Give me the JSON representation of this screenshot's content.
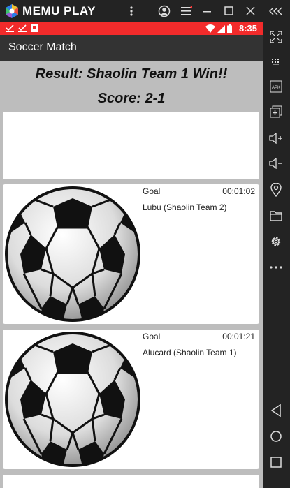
{
  "emulator": {
    "title": "MEMU PLAY",
    "controls": [
      "account-icon",
      "menu-icon",
      "minimize-icon",
      "maximize-icon",
      "close-icon",
      "collapse-icon"
    ]
  },
  "sidebar": {
    "buttons": [
      "fullscreen-icon",
      "keyboard-icon",
      "apk-icon",
      "add-app-icon",
      "volume-up-icon",
      "volume-down-icon",
      "location-icon",
      "folder-icon",
      "settings-icon",
      "more-icon",
      "back-icon",
      "home-icon",
      "recents-icon"
    ]
  },
  "status_bar": {
    "time": "8:35",
    "color": "#f22b2b"
  },
  "app": {
    "title": "Soccer Match"
  },
  "result": {
    "headline": "Result: Shaolin Team 1 Win!!",
    "score": "Score: 2-1"
  },
  "events": [
    {
      "type": "Goal",
      "time": "00:01:02",
      "player": "Lubu (Shaolin Team 2)"
    },
    {
      "type": "Goal",
      "time": "00:01:21",
      "player": "Alucard (Shaolin Team 1)"
    }
  ]
}
